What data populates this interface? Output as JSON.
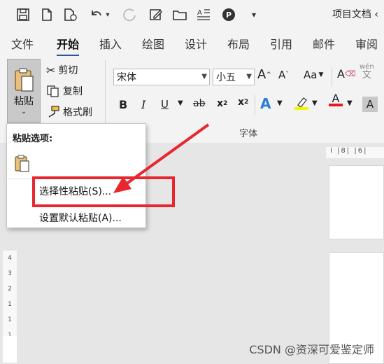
{
  "window": {
    "title": "项目文档 ‹"
  },
  "tabs": [
    "文件",
    "开始",
    "插入",
    "绘图",
    "设计",
    "布局",
    "引用",
    "邮件",
    "审阅"
  ],
  "clipboard": {
    "paste_label": "粘贴",
    "cut_label": "剪切",
    "copy_label": "复制",
    "format_painter_label": "格式刷"
  },
  "font": {
    "font_name": "宋体",
    "font_size": "小五",
    "group_label": "字体",
    "aa_label": "Aa",
    "wen_label": "wén",
    "wen_char": "文"
  },
  "paste_menu": {
    "header": "粘贴选项:",
    "items": [
      "选择性粘贴(S)...",
      "设置默认粘贴(A)..."
    ]
  },
  "ruler": {
    "top_marks": "I  |8|  |6|",
    "left_marks": [
      "4",
      "3",
      "2",
      "1",
      "1",
      "1"
    ]
  },
  "watermark": "CSDN @资深可爱鉴定师",
  "colors": {
    "accent": "#2b579a",
    "highlight": "#e8262e",
    "font_color": "#e02020",
    "highlighter": "#f5f500"
  }
}
